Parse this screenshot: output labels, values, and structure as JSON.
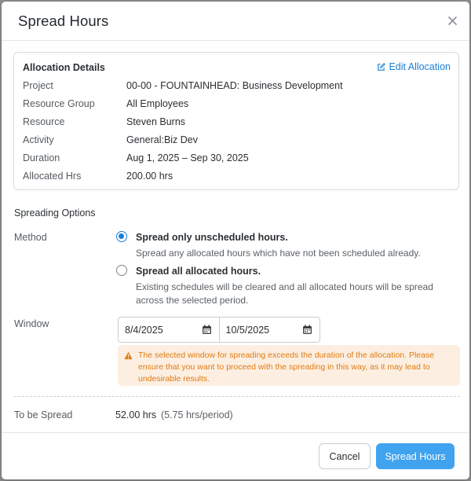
{
  "dialog": {
    "title": "Spread Hours"
  },
  "allocation": {
    "title": "Allocation Details",
    "edit_label": "Edit Allocation",
    "rows": [
      {
        "label": "Project",
        "value": "00-00 - FOUNTAINHEAD: Business Development"
      },
      {
        "label": "Resource Group",
        "value": "All Employees"
      },
      {
        "label": "Resource",
        "value": "Steven Burns"
      },
      {
        "label": "Activity",
        "value": "General:Biz Dev"
      },
      {
        "label": "Duration",
        "value": "Aug 1, 2025 – Sep 30, 2025"
      },
      {
        "label": "Allocated Hrs",
        "value": "200.00 hrs"
      }
    ]
  },
  "spreading": {
    "section_title": "Spreading Options",
    "method_label": "Method",
    "options": [
      {
        "title": "Spread only unscheduled hours.",
        "description": "Spread any allocated hours which have not been scheduled already.",
        "selected": true
      },
      {
        "title": "Spread all allocated hours.",
        "description": "Existing schedules will be cleared and all allocated hours will be spread across the selected period.",
        "selected": false
      }
    ],
    "window_label": "Window",
    "window_start": "8/4/2025",
    "window_end": "10/5/2025",
    "warning": "The selected window for spreading exceeds the duration of the allocation. Please ensure that you want to proceed with the spreading in this way, as it may lead to undesirable results."
  },
  "summary": {
    "label": "To be Spread",
    "hours": "52.00 hrs",
    "per_period": "(5.75 hrs/period)"
  },
  "footer": {
    "cancel_label": "Cancel",
    "submit_label": "Spread Hours"
  },
  "colors": {
    "accent": "#1a7fd4",
    "primary_button": "#3fa3ef",
    "warning_text": "#e07a12",
    "warning_bg": "#fcefe1"
  },
  "icons": {
    "close": "close-icon",
    "edit": "edit-icon",
    "calendar": "calendar-icon",
    "warning": "warning-icon"
  }
}
